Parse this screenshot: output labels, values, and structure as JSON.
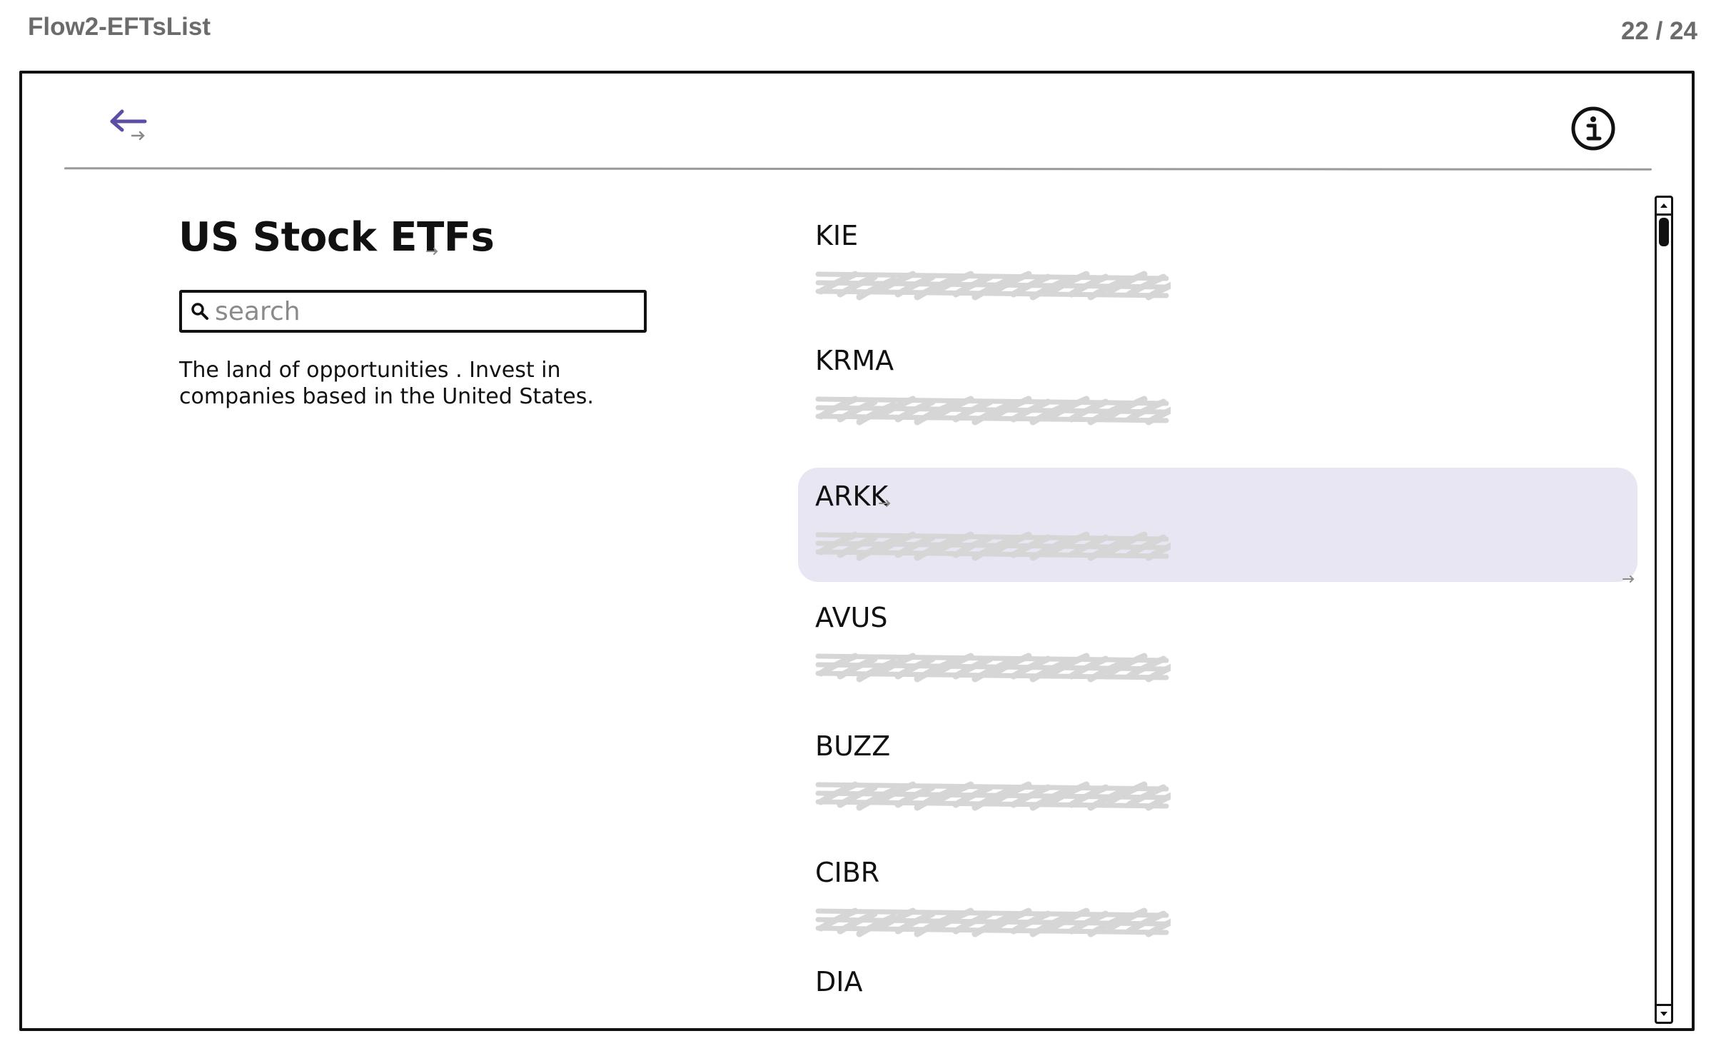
{
  "header": {
    "page_name": "Flow2-EFTsList",
    "page_counter": "22 / 24"
  },
  "nav": {
    "back_icon": "back-arrow-icon",
    "info_icon": "info-icon"
  },
  "main": {
    "title": "US Stock ETFs",
    "search": {
      "placeholder": "search",
      "value": ""
    },
    "description": "The land of opportunities . Invest in companies based in the United States."
  },
  "etf_list": {
    "items": [
      {
        "ticker": "KIE",
        "selected": false
      },
      {
        "ticker": "KRMA",
        "selected": false
      },
      {
        "ticker": "ARKK",
        "selected": true
      },
      {
        "ticker": "AVUS",
        "selected": false
      },
      {
        "ticker": "BUZZ",
        "selected": false
      },
      {
        "ticker": "CIBR",
        "selected": false
      },
      {
        "ticker": "DIA",
        "selected": false
      }
    ]
  },
  "colors": {
    "accent": "#5b4ea3",
    "selected_row": "#e9e6f3",
    "scribble": "#d6d6d6",
    "header_text": "#6b6b6b"
  }
}
